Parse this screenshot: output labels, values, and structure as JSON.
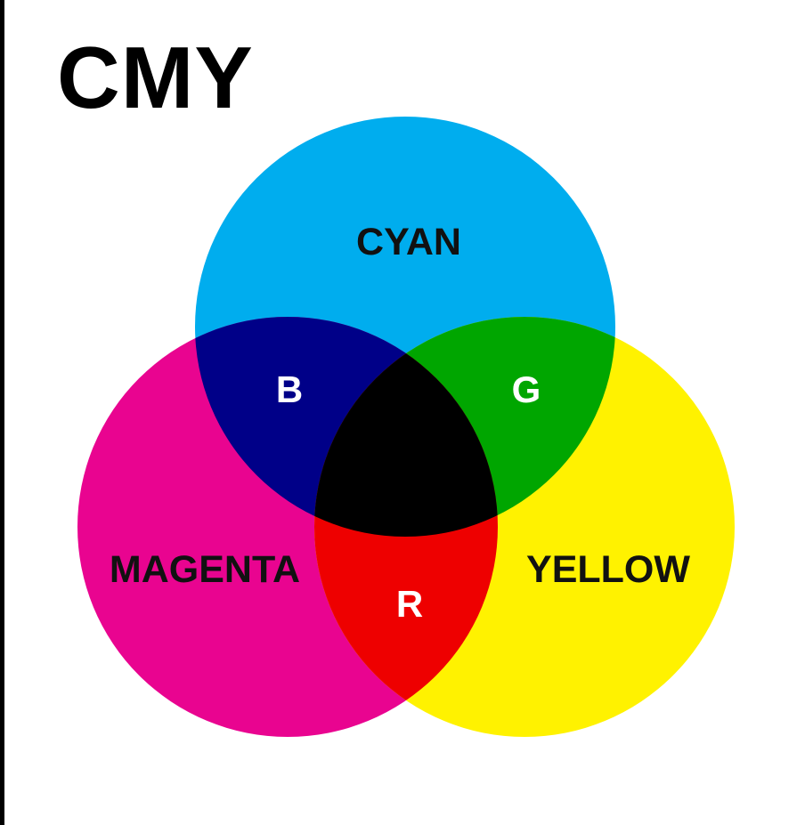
{
  "title": "CMY",
  "circles": {
    "cyan": {
      "label": "CYAN",
      "color": "#00ADEE"
    },
    "magenta": {
      "label": "MAGENTA",
      "color": "#E90490"
    },
    "yellow": {
      "label": "YELLOW",
      "color": "#FFF200"
    }
  },
  "overlaps": {
    "cyan_magenta": {
      "label": "B",
      "color": "#000088"
    },
    "cyan_yellow": {
      "label": "G",
      "color": "#00A600"
    },
    "magenta_yellow": {
      "label": "R",
      "color": "#EE0000"
    },
    "all": {
      "color": "#000000"
    }
  },
  "colors": {
    "primary_label": "#111111",
    "overlap_label": "#ffffff"
  }
}
